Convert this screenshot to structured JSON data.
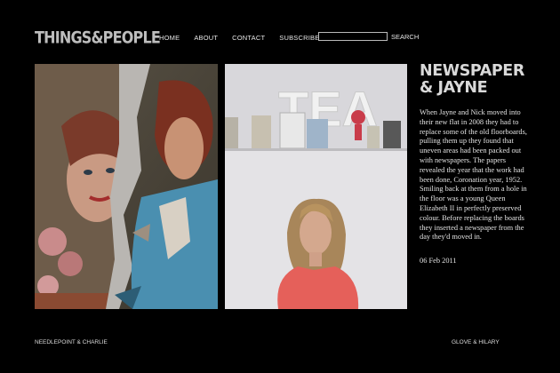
{
  "site": {
    "logo": "THINGS&PEOPLE"
  },
  "nav": [
    {
      "label": "HOME"
    },
    {
      "label": "ABOUT"
    },
    {
      "label": "CONTACT"
    },
    {
      "label": "SUBSCRIBE"
    }
  ],
  "search": {
    "button_label": "SEARCH",
    "value": ""
  },
  "article": {
    "title": "NEWSPAPER & JAYNE",
    "body": "When Jayne and Nick moved into their new flat in 2008 they had to replace some of the old floorboards, pulling them up they found that uneven areas had been packed out with newspapers. The papers revealed the year that the work had been done, Coronation year, 1952. Smiling back at them from a hole in the floor was a young Queen Elizabeth II in perfectly preserved colour. Before replacing the boards they inserted a newspaper from the day they'd moved in.",
    "date": "06 Feb 2011",
    "shelf_letters": "TEA"
  },
  "footer": {
    "prev_label": "NEEDLEPOINT & CHARLIE",
    "next_label": "GLOVE & HILARY"
  },
  "colors": {
    "background": "#000000",
    "text": "#ffffff",
    "logo": "#bdbdbd",
    "shirt": "#e5605a"
  }
}
